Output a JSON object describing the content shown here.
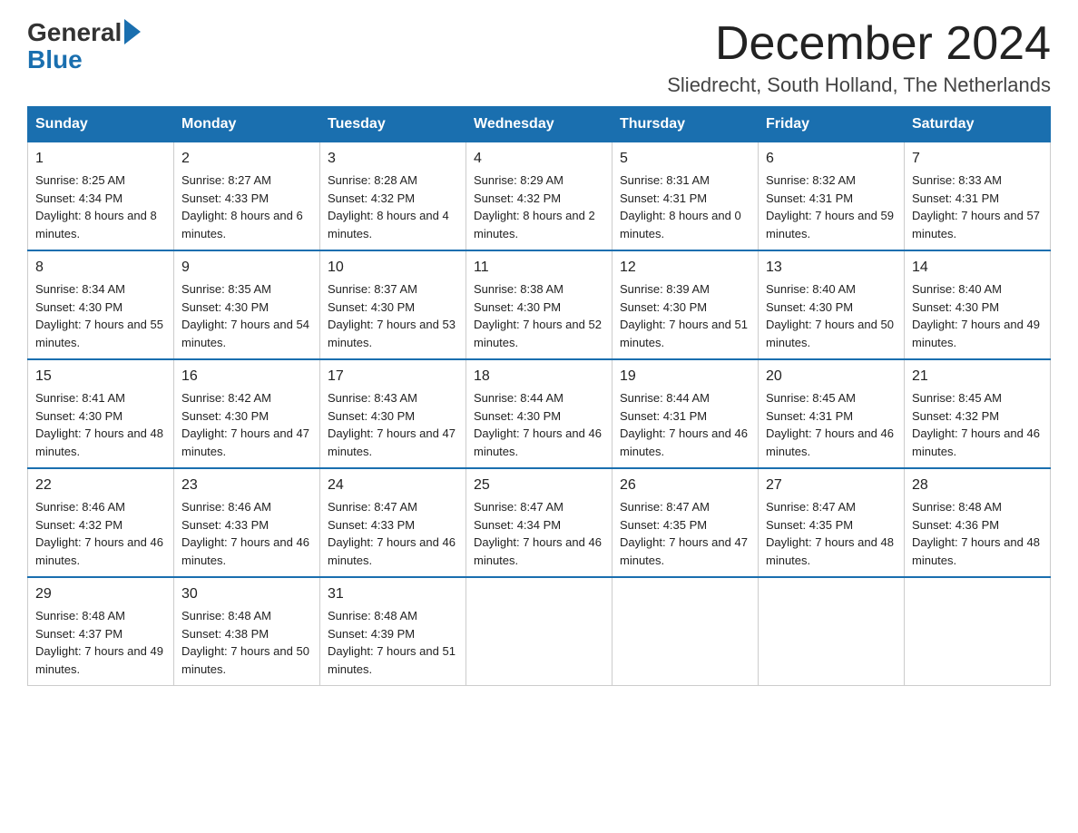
{
  "logo": {
    "general": "General",
    "blue": "Blue"
  },
  "title": {
    "month_year": "December 2024",
    "location": "Sliedrecht, South Holland, The Netherlands"
  },
  "weekdays": [
    "Sunday",
    "Monday",
    "Tuesday",
    "Wednesday",
    "Thursday",
    "Friday",
    "Saturday"
  ],
  "weeks": [
    [
      {
        "day": 1,
        "sunrise": "8:25 AM",
        "sunset": "4:34 PM",
        "daylight": "8 hours and 8 minutes."
      },
      {
        "day": 2,
        "sunrise": "8:27 AM",
        "sunset": "4:33 PM",
        "daylight": "8 hours and 6 minutes."
      },
      {
        "day": 3,
        "sunrise": "8:28 AM",
        "sunset": "4:32 PM",
        "daylight": "8 hours and 4 minutes."
      },
      {
        "day": 4,
        "sunrise": "8:29 AM",
        "sunset": "4:32 PM",
        "daylight": "8 hours and 2 minutes."
      },
      {
        "day": 5,
        "sunrise": "8:31 AM",
        "sunset": "4:31 PM",
        "daylight": "8 hours and 0 minutes."
      },
      {
        "day": 6,
        "sunrise": "8:32 AM",
        "sunset": "4:31 PM",
        "daylight": "7 hours and 59 minutes."
      },
      {
        "day": 7,
        "sunrise": "8:33 AM",
        "sunset": "4:31 PM",
        "daylight": "7 hours and 57 minutes."
      }
    ],
    [
      {
        "day": 8,
        "sunrise": "8:34 AM",
        "sunset": "4:30 PM",
        "daylight": "7 hours and 55 minutes."
      },
      {
        "day": 9,
        "sunrise": "8:35 AM",
        "sunset": "4:30 PM",
        "daylight": "7 hours and 54 minutes."
      },
      {
        "day": 10,
        "sunrise": "8:37 AM",
        "sunset": "4:30 PM",
        "daylight": "7 hours and 53 minutes."
      },
      {
        "day": 11,
        "sunrise": "8:38 AM",
        "sunset": "4:30 PM",
        "daylight": "7 hours and 52 minutes."
      },
      {
        "day": 12,
        "sunrise": "8:39 AM",
        "sunset": "4:30 PM",
        "daylight": "7 hours and 51 minutes."
      },
      {
        "day": 13,
        "sunrise": "8:40 AM",
        "sunset": "4:30 PM",
        "daylight": "7 hours and 50 minutes."
      },
      {
        "day": 14,
        "sunrise": "8:40 AM",
        "sunset": "4:30 PM",
        "daylight": "7 hours and 49 minutes."
      }
    ],
    [
      {
        "day": 15,
        "sunrise": "8:41 AM",
        "sunset": "4:30 PM",
        "daylight": "7 hours and 48 minutes."
      },
      {
        "day": 16,
        "sunrise": "8:42 AM",
        "sunset": "4:30 PM",
        "daylight": "7 hours and 47 minutes."
      },
      {
        "day": 17,
        "sunrise": "8:43 AM",
        "sunset": "4:30 PM",
        "daylight": "7 hours and 47 minutes."
      },
      {
        "day": 18,
        "sunrise": "8:44 AM",
        "sunset": "4:30 PM",
        "daylight": "7 hours and 46 minutes."
      },
      {
        "day": 19,
        "sunrise": "8:44 AM",
        "sunset": "4:31 PM",
        "daylight": "7 hours and 46 minutes."
      },
      {
        "day": 20,
        "sunrise": "8:45 AM",
        "sunset": "4:31 PM",
        "daylight": "7 hours and 46 minutes."
      },
      {
        "day": 21,
        "sunrise": "8:45 AM",
        "sunset": "4:32 PM",
        "daylight": "7 hours and 46 minutes."
      }
    ],
    [
      {
        "day": 22,
        "sunrise": "8:46 AM",
        "sunset": "4:32 PM",
        "daylight": "7 hours and 46 minutes."
      },
      {
        "day": 23,
        "sunrise": "8:46 AM",
        "sunset": "4:33 PM",
        "daylight": "7 hours and 46 minutes."
      },
      {
        "day": 24,
        "sunrise": "8:47 AM",
        "sunset": "4:33 PM",
        "daylight": "7 hours and 46 minutes."
      },
      {
        "day": 25,
        "sunrise": "8:47 AM",
        "sunset": "4:34 PM",
        "daylight": "7 hours and 46 minutes."
      },
      {
        "day": 26,
        "sunrise": "8:47 AM",
        "sunset": "4:35 PM",
        "daylight": "7 hours and 47 minutes."
      },
      {
        "day": 27,
        "sunrise": "8:47 AM",
        "sunset": "4:35 PM",
        "daylight": "7 hours and 48 minutes."
      },
      {
        "day": 28,
        "sunrise": "8:48 AM",
        "sunset": "4:36 PM",
        "daylight": "7 hours and 48 minutes."
      }
    ],
    [
      {
        "day": 29,
        "sunrise": "8:48 AM",
        "sunset": "4:37 PM",
        "daylight": "7 hours and 49 minutes."
      },
      {
        "day": 30,
        "sunrise": "8:48 AM",
        "sunset": "4:38 PM",
        "daylight": "7 hours and 50 minutes."
      },
      {
        "day": 31,
        "sunrise": "8:48 AM",
        "sunset": "4:39 PM",
        "daylight": "7 hours and 51 minutes."
      },
      null,
      null,
      null,
      null
    ]
  ]
}
